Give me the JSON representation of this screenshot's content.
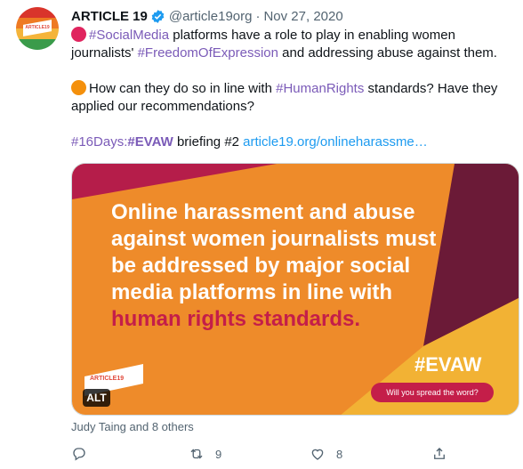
{
  "author": {
    "name": "ARTICLE 19",
    "handle": "@article19org",
    "separator": "·",
    "date": "Nov 27, 2020",
    "avatar_logo_text": "ARTICLE19"
  },
  "tweet": {
    "line1_tag1": "#SocialMedia",
    "line1_text1": " platforms have a role to play in enabling women journalists' ",
    "line1_tag2": "#FreedomOfExpression",
    "line1_text2": " and addressing abuse against them.",
    "line2_text1": "How can they do so in line with ",
    "line2_tag": "#HumanRights",
    "line2_text2": " standards? Have they applied our recommendations?",
    "line3_tag1": "#16Days",
    "line3_colon": ":",
    "line3_tag2": "#EVAW",
    "line3_text": " briefing #2 ",
    "line3_link": "article19.org/onlineharassme…"
  },
  "media": {
    "headline_white": "Online harassment and abuse against women journalists must be addressed by major social media platforms in line with",
    "headline_highlight": "human rights standards.",
    "hashtag": "#EVAW",
    "button_label": "Will you spread the word?",
    "logo_text": "ARTICLE19",
    "alt_badge": "ALT"
  },
  "liked_by": "Judy Taing and 8 others",
  "actions": {
    "retweet_count": "9",
    "like_count": "8"
  },
  "colors": {
    "red_dot": "#e0245e",
    "orange_dot": "#f4900c",
    "hashtag": "#7b5bb8",
    "link": "#1d9bf0",
    "image_orange": "#ee8b2a",
    "image_dark": "#6b1a37",
    "image_yellow": "#f2b234",
    "image_magenta": "#b51d4a"
  },
  "icons": [
    "verified-badge-icon",
    "reply-icon",
    "retweet-icon",
    "like-icon",
    "share-icon"
  ]
}
